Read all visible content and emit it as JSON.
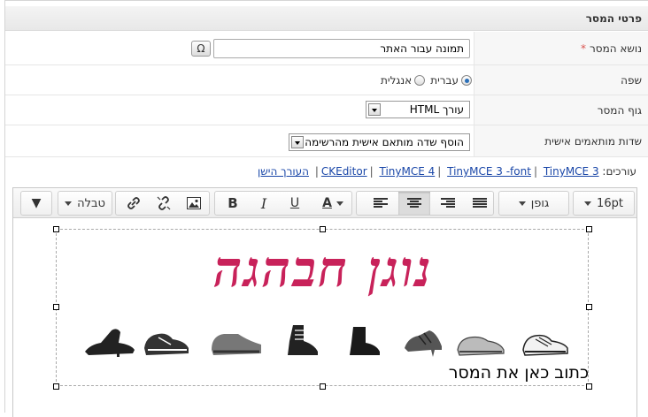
{
  "panel": {
    "title": "פרטי המסר"
  },
  "fields": {
    "subject": {
      "label": "נושא המסר",
      "required_mark": "*",
      "value": "תמונה עבור האתר",
      "special_char_btn": "Ω"
    },
    "language": {
      "label": "שפה",
      "options": [
        {
          "label": "עברית",
          "selected": true
        },
        {
          "label": "אנגלית",
          "selected": false
        }
      ]
    },
    "body": {
      "label": "גוף המסר",
      "selected": "עורך HTML"
    },
    "custom_fields": {
      "label": "שדות מותאמים אישית",
      "selected": "הוסף שדה מותאם אישית מהרשימה"
    }
  },
  "editors": {
    "label": "עורכים:",
    "links": [
      "CKEditor",
      "TinyMCE 4",
      "TinyMCE 3 -font",
      "TinyMCE 3",
      "העורך הישן"
    ]
  },
  "toolbar": {
    "font_size": "16pt",
    "font_family": "גופן",
    "text_color_label": "A",
    "bold": "B",
    "italic": "I",
    "underline": "U",
    "table": "טבלה",
    "more": "▼"
  },
  "content": {
    "logo_text": "נוגן חבהגה",
    "body_text": "כתוב כאן את המסר"
  },
  "icons": [
    "omega-icon",
    "radio-icon",
    "dropdown-arrow-icon",
    "align-left-icon",
    "align-center-icon",
    "align-right-icon",
    "align-justify-icon",
    "text-color-icon",
    "bold-icon",
    "italic-icon",
    "underline-icon",
    "image-icon",
    "unlink-icon",
    "link-icon",
    "caret-down-icon",
    "shoe-icon"
  ],
  "colors": {
    "logo": "#c8225a",
    "link": "#1a47a8",
    "required": "#d9534f"
  }
}
